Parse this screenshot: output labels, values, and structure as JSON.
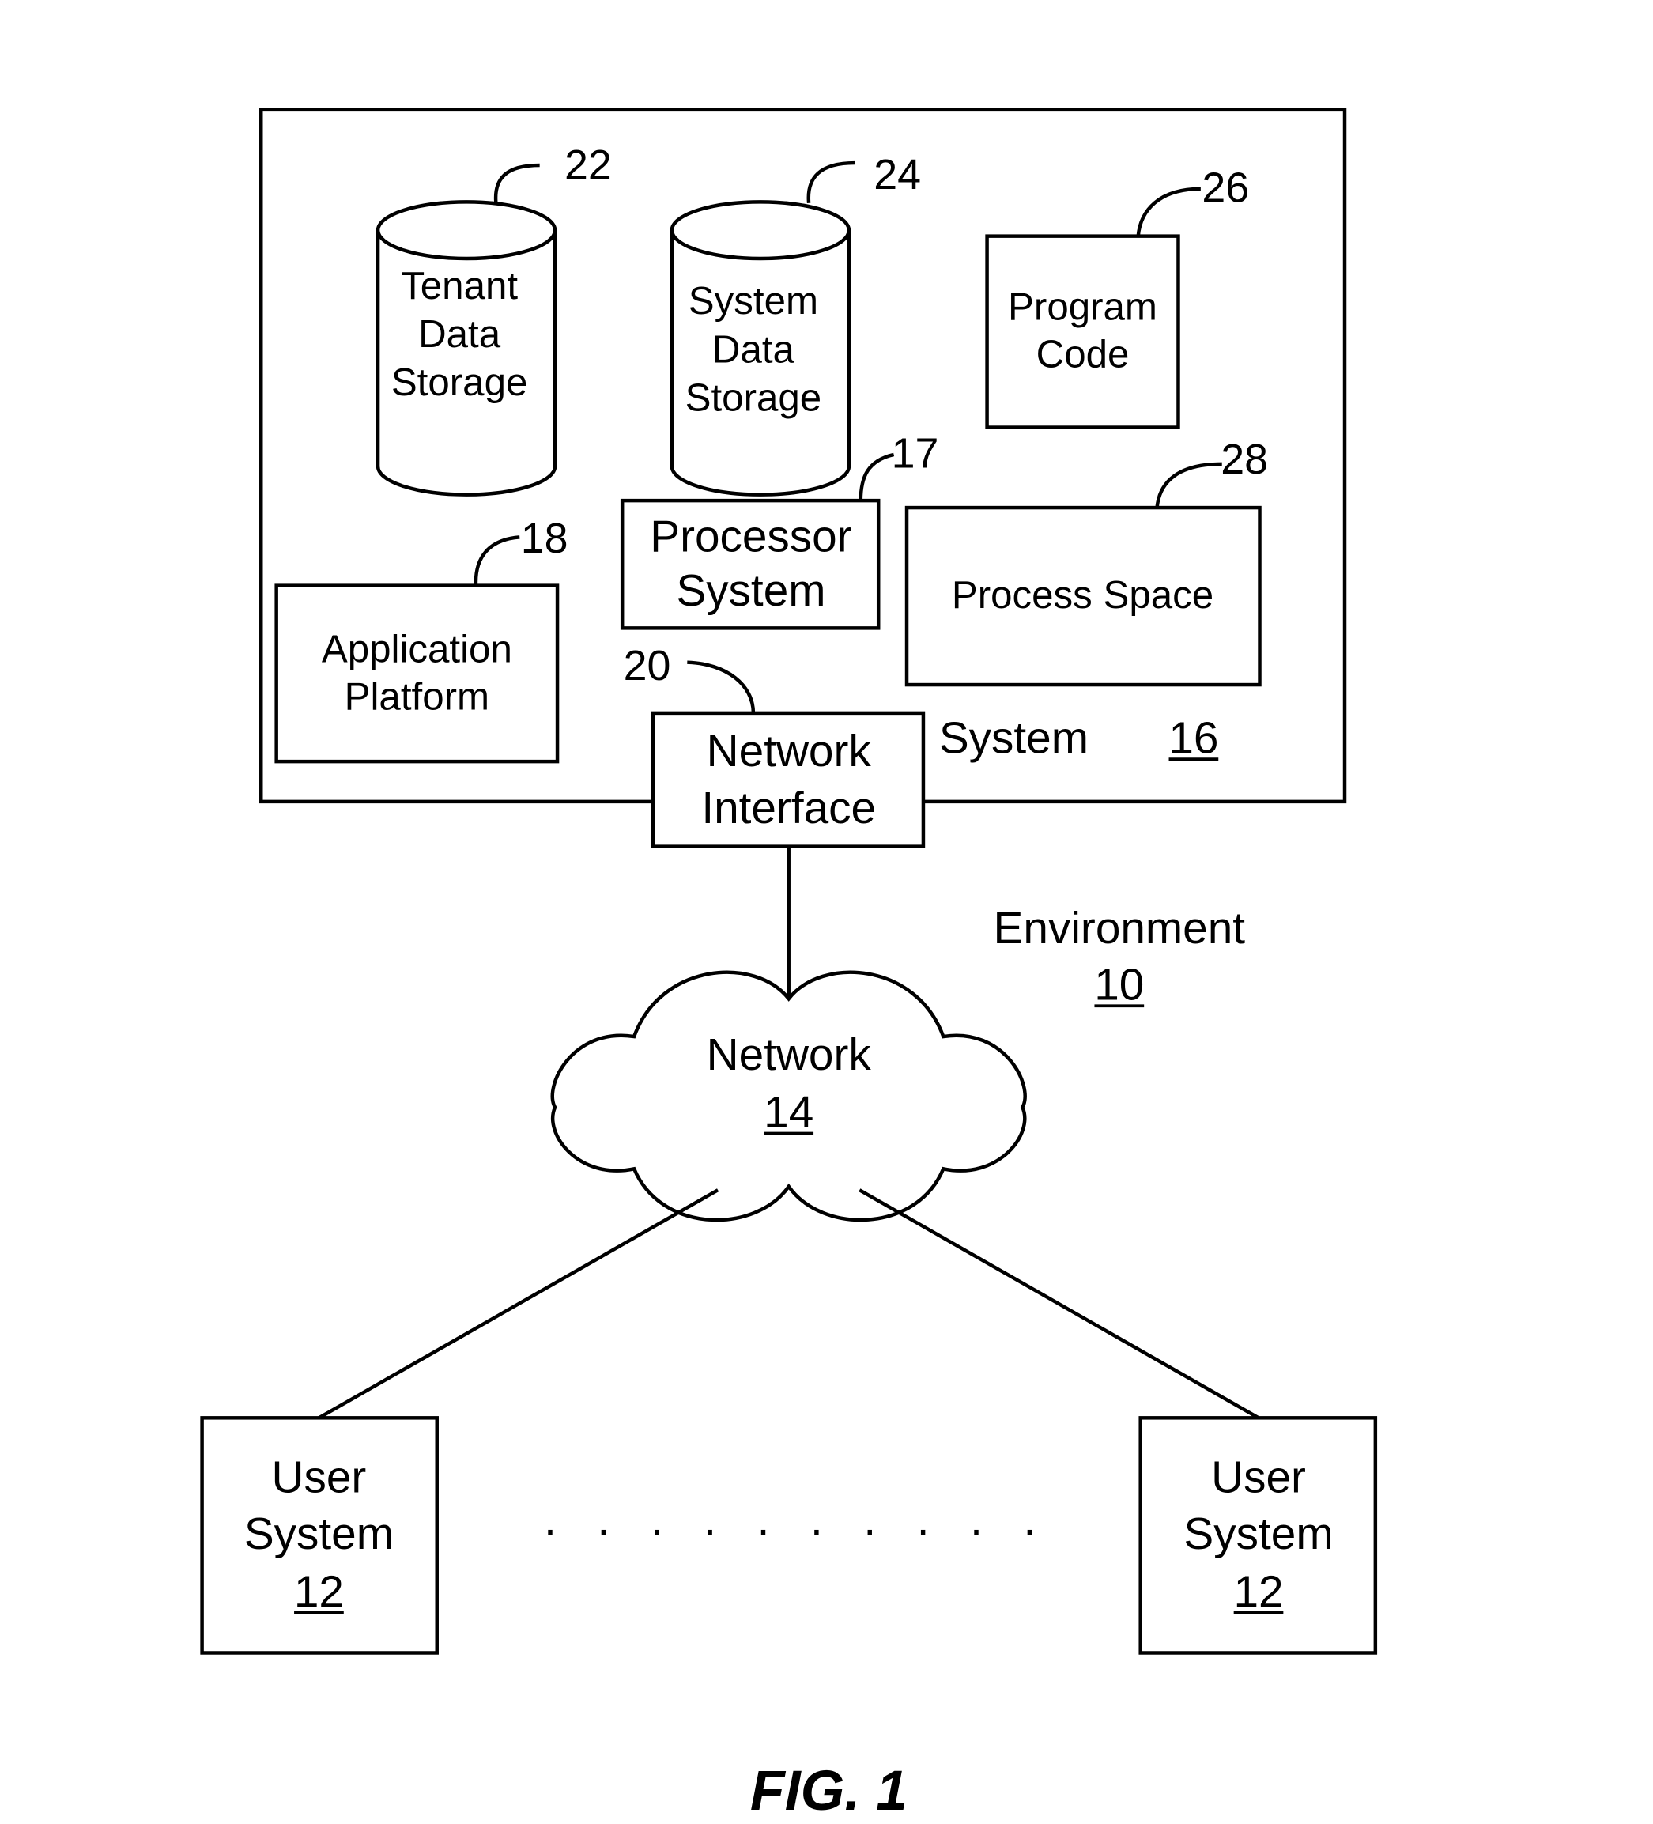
{
  "figure": {
    "caption": "FIG. 1",
    "environment": {
      "label": "Environment",
      "ref": "10"
    },
    "system": {
      "label": "System",
      "ref": "16"
    },
    "components": {
      "tenant_storage": {
        "lines": [
          "Tenant",
          "Data",
          "Storage"
        ],
        "ref": "22"
      },
      "system_storage": {
        "lines": [
          "System",
          "Data",
          "Storage"
        ],
        "ref": "24"
      },
      "program_code": {
        "lines": [
          "Program",
          "Code"
        ],
        "ref": "26"
      },
      "processor_system": {
        "lines": [
          "Processor",
          "System"
        ],
        "ref": "17"
      },
      "process_space": {
        "label": "Process Space",
        "ref": "28"
      },
      "application_platform": {
        "lines": [
          "Application",
          "Platform"
        ],
        "ref": "18"
      },
      "network_interface": {
        "lines": [
          "Network",
          "Interface"
        ],
        "ref": "20"
      }
    },
    "network": {
      "label": "Network",
      "ref": "14"
    },
    "user_systems": [
      {
        "lines": [
          "User",
          "System"
        ],
        "ref": "12"
      },
      {
        "lines": [
          "User",
          "System"
        ],
        "ref": "12"
      }
    ],
    "ellipsis": ". . . . . . . . . ."
  }
}
